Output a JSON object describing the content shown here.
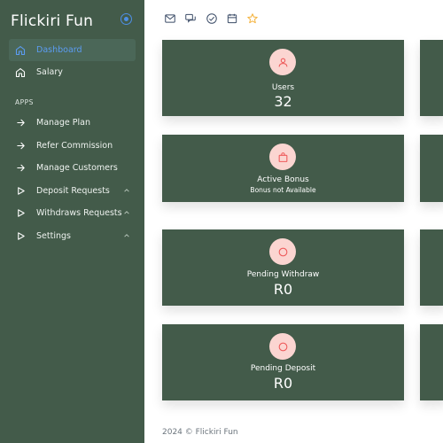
{
  "app": {
    "title": "Flickiri Fun"
  },
  "sidebar": {
    "main_items": [
      {
        "label": "Dashboard",
        "icon": "home-icon",
        "active": true
      },
      {
        "label": "Salary",
        "icon": "home-icon",
        "active": false
      }
    ],
    "section_label": "APPS",
    "app_items": [
      {
        "label": "Manage Plan",
        "icon": "arrow-right-icon"
      },
      {
        "label": "Refer Commission",
        "icon": "arrow-right-icon"
      },
      {
        "label": "Manage Customers",
        "icon": "arrow-right-icon"
      },
      {
        "label": "Deposit Requests",
        "icon": "play-outline-icon",
        "has_submenu": true
      },
      {
        "label": "Withdraws Requests",
        "icon": "play-outline-icon",
        "has_submenu": true
      },
      {
        "label": "Settings",
        "icon": "play-outline-icon",
        "has_submenu": true
      }
    ]
  },
  "topbar": {
    "icons": [
      "mail-icon",
      "chat-icon",
      "check-circle-icon",
      "calendar-icon",
      "star-icon"
    ]
  },
  "cards": [
    {
      "title": "Users",
      "value": "32",
      "icon": "user-icon"
    },
    {
      "title": "Active Bonus",
      "subtitle": "Bonus not Available",
      "icon": "bag-icon"
    },
    {
      "title": "Pending Withdraw",
      "value": "R0",
      "icon": "circle-icon"
    },
    {
      "title": "Pending Deposit",
      "value": "R0",
      "icon": "circle-icon"
    }
  ],
  "footer": {
    "text": "2024 © Flickiri Fun"
  },
  "colors": {
    "sidebar_bg": "#435b4a",
    "card_bg": "#435b4a",
    "accent": "#5b9cf2",
    "icon_circle": "#fbd5d1",
    "icon_stroke": "#ee5b5b",
    "star": "#f4b13a"
  }
}
